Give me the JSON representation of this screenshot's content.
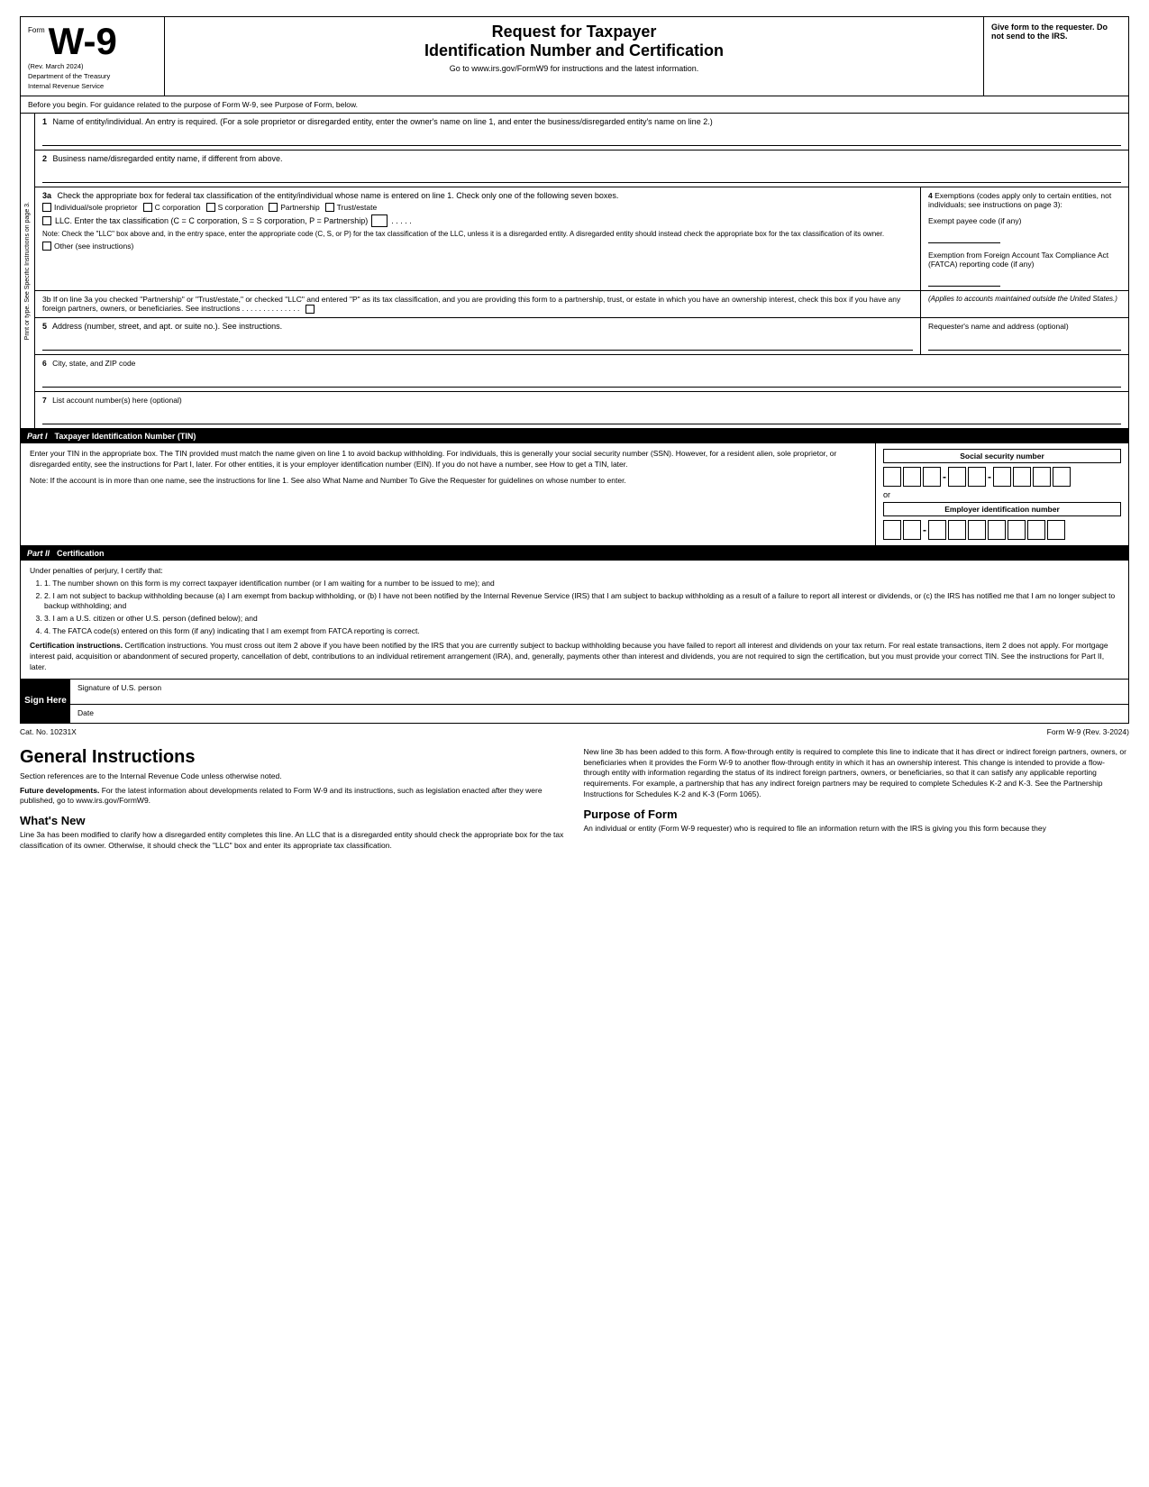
{
  "header": {
    "form_label": "Form",
    "form_number": "W-9",
    "rev_date": "(Rev. March 2024)",
    "dept": "Department of the Treasury",
    "irs": "Internal Revenue Service",
    "title_line1": "Request for Taxpayer",
    "title_line2": "Identification Number and Certification",
    "website_text": "Go to www.irs.gov/FormW9 for instructions and the latest information.",
    "give_form": "Give form to the requester. Do not send to the IRS."
  },
  "before_begin": {
    "text": "Before you begin. For guidance related to the purpose of Form W-9, see Purpose of Form, below."
  },
  "fields": {
    "line1_label": "1",
    "line1_desc": "Name of entity/individual. An entry is required. (For a sole proprietor or disregarded entity, enter the owner's name on line 1, and enter the business/disregarded entity's name on line 2.)",
    "line2_label": "2",
    "line2_desc": "Business name/disregarded entity name, if different from above.",
    "line3a_label": "3a",
    "line3a_desc": "Check the appropriate box for federal tax classification of the entity/individual whose name is entered on line 1. Check only one of the following seven boxes.",
    "cb_individual": "Individual/sole proprietor",
    "cb_c_corp": "C corporation",
    "cb_s_corp": "S corporation",
    "cb_partnership": "Partnership",
    "cb_trust": "Trust/estate",
    "cb_llc": "LLC. Enter the tax classification (C = C corporation, S = S corporation, P = Partnership)",
    "llc_dots": ". . . . .",
    "note_text": "Note: Check the \"LLC\" box above and, in the entry space, enter the appropriate code (C, S, or P) for the tax classification of the LLC, unless it is a disregarded entity. A disregarded entity should instead check the appropriate box for the tax classification of its owner.",
    "cb_other": "Other (see instructions)",
    "line4_label": "4",
    "line4_desc": "Exemptions (codes apply only to certain entities, not individuals; see instructions on page 3):",
    "exempt_payee": "Exempt payee code (if any)",
    "fatca_exemption": "Exemption from Foreign Account Tax Compliance Act (FATCA) reporting code (if any)",
    "line3b_text": "3b If on line 3a you checked \"Partnership\" or \"Trust/estate,\" or checked \"LLC\" and entered \"P\" as its tax classification, and you are providing this form to a partnership, trust, or estate in which you have an ownership interest, check this box if you have any foreign partners, owners, or beneficiaries. See instructions . . . . . . . . . . . . . .",
    "applies_text": "(Applies to accounts maintained outside the United States.)",
    "line5_label": "5",
    "line5_desc": "Address (number, street, and apt. or suite no.). See instructions.",
    "requester_label": "Requester's name and address (optional)",
    "line6_label": "6",
    "line6_desc": "City, state, and ZIP code",
    "line7_label": "7",
    "line7_desc": "List account number(s) here (optional)"
  },
  "part1": {
    "label": "Part I",
    "title": "Taxpayer Identification Number (TIN)",
    "intro_text": "Enter your TIN in the appropriate box. The TIN provided must match the name given on line 1 to avoid backup withholding. For individuals, this is generally your social security number (SSN). However, for a resident alien, sole proprietor, or disregarded entity, see the instructions for Part I, later. For other entities, it is your employer identification number (EIN). If you do not have a number, see How to get a TIN, later.",
    "note_text": "Note: If the account is in more than one name, see the instructions for line 1. See also What Name and Number To Give the Requester for guidelines on whose number to enter.",
    "ssn_label": "Social security number",
    "or_text": "or",
    "ein_label": "Employer identification number"
  },
  "part2": {
    "label": "Part II",
    "title": "Certification",
    "under_penalties": "Under penalties of perjury, I certify that:",
    "items": [
      "1. The number shown on this form is my correct taxpayer identification number (or I am waiting for a number to be issued to me); and",
      "2. I am not subject to backup withholding because (a) I am exempt from backup withholding, or (b) I have not been notified by the Internal Revenue Service (IRS) that I am subject to backup withholding as a result of a failure to report all interest or dividends, or (c) the IRS has notified me that I am no longer subject to backup withholding; and",
      "3. I am a U.S. citizen or other U.S. person (defined below); and",
      "4. The FATCA code(s) entered on this form (if any) indicating that I am exempt from FATCA reporting is correct."
    ],
    "cert_instructions": "Certification instructions. You must cross out item 2 above if you have been notified by the IRS that you are currently subject to backup withholding because you have failed to report all interest and dividends on your tax return. For real estate transactions, item 2 does not apply. For mortgage interest paid, acquisition or abandonment of secured property, cancellation of debt, contributions to an individual retirement arrangement (IRA), and, generally, payments other than interest and dividends, you are not required to sign the certification, but you must provide your correct TIN. See the instructions for Part II, later."
  },
  "sign": {
    "sign_here": "Sign Here",
    "sig_label": "Signature of U.S. person",
    "date_label": "Date"
  },
  "footer": {
    "cat_no": "Cat. No. 10231X",
    "form_label": "Form W-9 (Rev. 3-2024)"
  },
  "general_instructions": {
    "title": "General Instructions",
    "section_refs": "Section references are to the Internal Revenue Code unless otherwise noted.",
    "future_dev_title": "Future developments.",
    "future_dev_text": "For the latest information about developments related to Form W-9 and its instructions, such as legislation enacted after they were published, go to www.irs.gov/FormW9.",
    "whats_new_title": "What's New",
    "whats_new_text": "Line 3a has been modified to clarify how a disregarded entity completes this line. An LLC that is a disregarded entity should check the appropriate box for the tax classification of its owner. Otherwise, it should check the \"LLC\" box and enter its appropriate tax classification.",
    "new_line_3b_title": "",
    "right_col_text": "New line 3b has been added to this form. A flow-through entity is required to complete this line to indicate that it has direct or indirect foreign partners, owners, or beneficiaries when it provides the Form W-9 to another flow-through entity in which it has an ownership interest. This change is intended to provide a flow-through entity with information regarding the status of its indirect foreign partners, owners, or beneficiaries, so that it can satisfy any applicable reporting requirements. For example, a partnership that has any indirect foreign partners may be required to complete Schedules K-2 and K-3. See the Partnership Instructions for Schedules K-2 and K-3 (Form 1065).",
    "purpose_title": "Purpose of Form",
    "purpose_text": "An individual or entity (Form W-9 requester) who is required to file an information return with the IRS is giving you this form because they"
  },
  "side_label": {
    "text": "Print or type. See Specific Instructions on page 3."
  }
}
